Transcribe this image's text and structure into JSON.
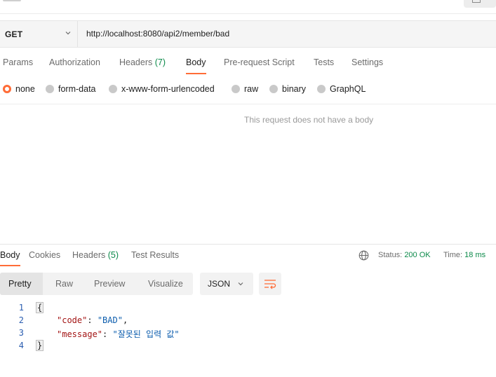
{
  "request": {
    "method": "GET",
    "url": "http://localhost:8080/api2/member/bad"
  },
  "request_tabs": [
    {
      "label": "Params",
      "count": ""
    },
    {
      "label": "Authorization",
      "count": ""
    },
    {
      "label": "Headers",
      "count": "(7)"
    },
    {
      "label": "Body",
      "count": ""
    },
    {
      "label": "Pre-request Script",
      "count": ""
    },
    {
      "label": "Tests",
      "count": ""
    },
    {
      "label": "Settings",
      "count": ""
    }
  ],
  "active_request_tab": "Body",
  "body_options": [
    "none",
    "form-data",
    "x-www-form-urlencoded",
    "raw",
    "binary",
    "GraphQL"
  ],
  "selected_body_option": "none",
  "no_body_message": "This request does not have a body",
  "response": {
    "tabs": [
      {
        "label": "Body",
        "count": ""
      },
      {
        "label": "Cookies",
        "count": ""
      },
      {
        "label": "Headers",
        "count": "(5)"
      },
      {
        "label": "Test Results",
        "count": ""
      }
    ],
    "status_label": "Status:",
    "status_value": "200 OK",
    "time_label": "Time:",
    "time_value": "18 ms",
    "view_modes": [
      "Pretty",
      "Raw",
      "Preview",
      "Visualize"
    ],
    "active_view_mode": "Pretty",
    "format": "JSON",
    "code_lines": [
      {
        "num": "1",
        "text": "{"
      },
      {
        "num": "2",
        "key": "\"code\"",
        "value": "\"BAD\"",
        "trail": ","
      },
      {
        "num": "3",
        "key": "\"message\"",
        "value": "\"잘못된 입력 값\"",
        "trail": ""
      },
      {
        "num": "4",
        "text": "}"
      }
    ]
  },
  "colors": {
    "accent": "#ff6c37",
    "status_ok": "#0c8a4a",
    "json_key": "#a31515",
    "json_string": "#0b5cad"
  }
}
